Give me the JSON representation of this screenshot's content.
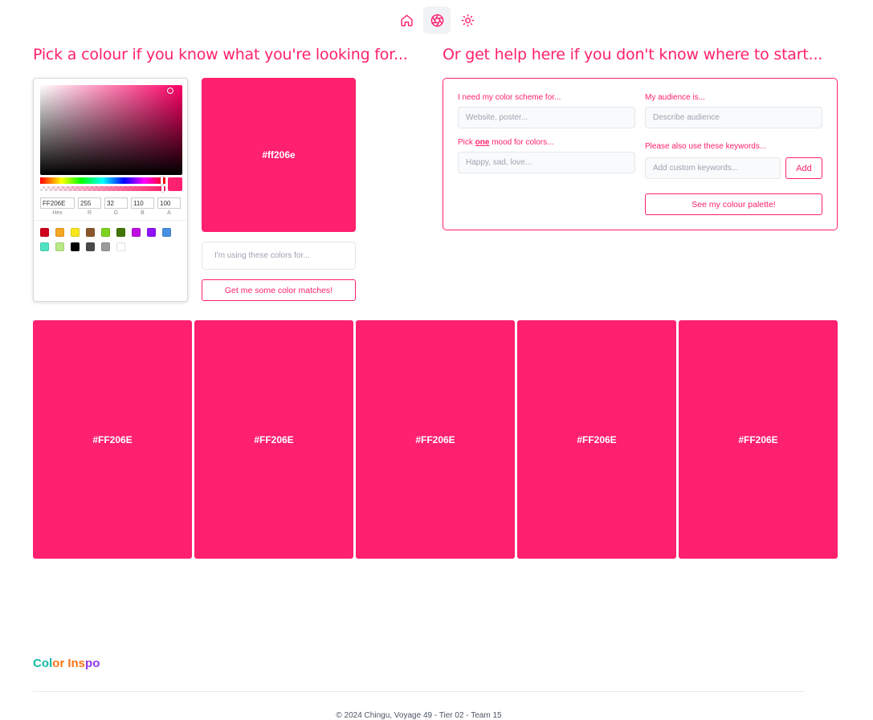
{
  "nav": {
    "items": [
      {
        "icon": "home-icon",
        "active": false
      },
      {
        "icon": "aperture-icon",
        "active": true
      },
      {
        "icon": "sun-icon",
        "active": false
      }
    ]
  },
  "colors": {
    "accent": "#ff206e",
    "brand_gradient": [
      "#14b8a6",
      "#f97316",
      "#9333ea"
    ]
  },
  "left": {
    "heading": "Pick a colour if you know what you're looking for...",
    "picker": {
      "hex": "FF206E",
      "r": "255",
      "g": "32",
      "b": "110",
      "a": "100",
      "labels": {
        "hex": "Hex",
        "r": "R",
        "g": "G",
        "b": "B",
        "a": "A"
      },
      "presets": [
        "#d0021b",
        "#f5a623",
        "#f8e71c",
        "#8b572a",
        "#7ed321",
        "#417505",
        "#bd10e0",
        "#9013fe",
        "#4a90e2",
        "#50e3c2",
        "#b8e986",
        "#000000",
        "#4a4a4a",
        "#9b9b9b",
        "#ffffff"
      ]
    },
    "preview_label": "#ff206e",
    "usage_placeholder": "I'm using these colors for...",
    "match_button": "Get me some color matches!"
  },
  "right": {
    "heading": "Or get help here if you don't know where to start...",
    "scheme_label": "I need my color scheme for...",
    "scheme_placeholder": "Website, poster...",
    "audience_label": "My audience is...",
    "audience_placeholder": "Describe audience",
    "mood_label_pre": "Pick ",
    "mood_label_em": "one",
    "mood_label_post": " mood for colors...",
    "mood_placeholder": "Happy, sad, love...",
    "keywords_label": "Please also use these keywords...",
    "keywords_placeholder": "Add custom keywords...",
    "add_button": "Add",
    "palette_button": "See my colour palette!"
  },
  "results": [
    {
      "hex": "#FF206E"
    },
    {
      "hex": "#FF206E"
    },
    {
      "hex": "#FF206E"
    },
    {
      "hex": "#FF206E"
    },
    {
      "hex": "#FF206E"
    }
  ],
  "footer": {
    "brand_parts": [
      "Color",
      " ",
      "Inspo"
    ],
    "copyright": "© 2024 Chingu, Voyage 49 - Tier 02 - Team 15"
  }
}
